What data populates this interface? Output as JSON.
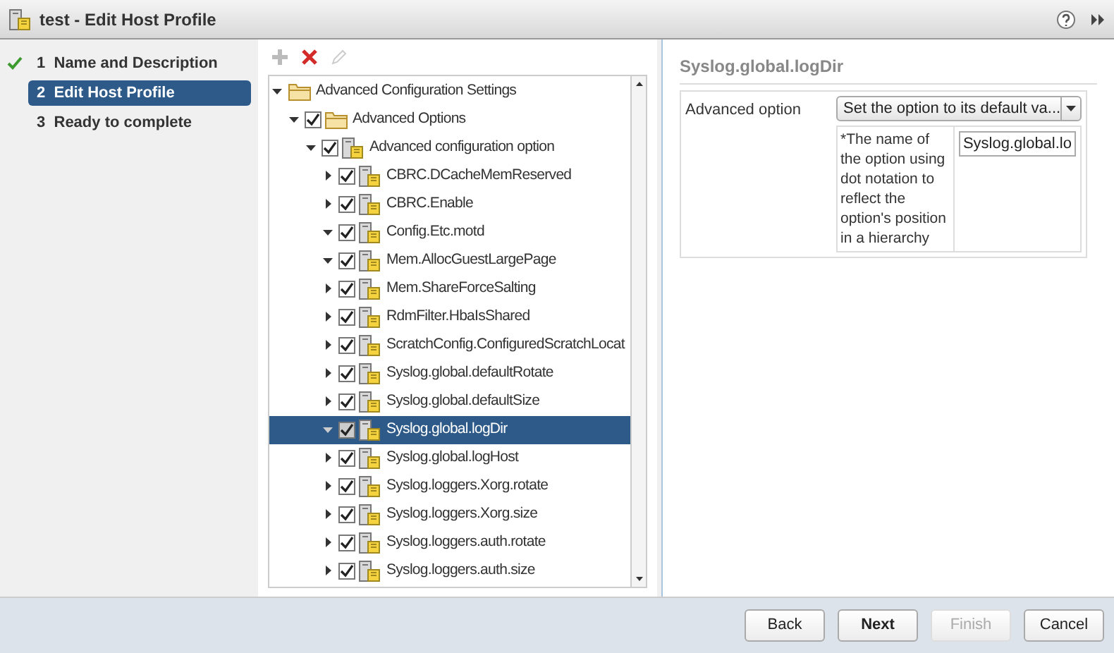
{
  "window": {
    "title": "test - Edit Host Profile"
  },
  "steps": [
    {
      "number": "1",
      "label": "Name and Description",
      "done": true,
      "selected": false
    },
    {
      "number": "2",
      "label": "Edit Host Profile",
      "done": false,
      "selected": true
    },
    {
      "number": "3",
      "label": "Ready to complete",
      "done": false,
      "selected": false
    }
  ],
  "tree": [
    {
      "label": "Advanced Configuration Settings",
      "kind": "folder",
      "expanded": true,
      "children": [
        {
          "label": "Advanced Options",
          "kind": "folder",
          "checked": true,
          "expanded": true,
          "children": [
            {
              "label": "Advanced configuration option",
              "kind": "profile",
              "checked": true,
              "expanded": true,
              "children": [
                {
                  "label": "CBRC.DCacheMemReserved",
                  "kind": "profile",
                  "checked": true,
                  "expanded": false,
                  "selected": false
                },
                {
                  "label": "CBRC.Enable",
                  "kind": "profile",
                  "checked": true,
                  "expanded": false,
                  "selected": false
                },
                {
                  "label": "Config.Etc.motd",
                  "kind": "profile",
                  "checked": true,
                  "expanded": true,
                  "selected": false
                },
                {
                  "label": "Mem.AllocGuestLargePage",
                  "kind": "profile",
                  "checked": true,
                  "expanded": true,
                  "selected": false
                },
                {
                  "label": "Mem.ShareForceSalting",
                  "kind": "profile",
                  "checked": true,
                  "expanded": false,
                  "selected": false
                },
                {
                  "label": "RdmFilter.HbaIsShared",
                  "kind": "profile",
                  "checked": true,
                  "expanded": false,
                  "selected": false
                },
                {
                  "label": "ScratchConfig.ConfiguredScratchLocat",
                  "kind": "profile",
                  "checked": true,
                  "expanded": false,
                  "selected": false
                },
                {
                  "label": "Syslog.global.defaultRotate",
                  "kind": "profile",
                  "checked": true,
                  "expanded": false,
                  "selected": false
                },
                {
                  "label": "Syslog.global.defaultSize",
                  "kind": "profile",
                  "checked": true,
                  "expanded": false,
                  "selected": false
                },
                {
                  "label": "Syslog.global.logDir",
                  "kind": "profile",
                  "checked": true,
                  "expanded": true,
                  "selected": true
                },
                {
                  "label": "Syslog.global.logHost",
                  "kind": "profile",
                  "checked": true,
                  "expanded": false,
                  "selected": false
                },
                {
                  "label": "Syslog.loggers.Xorg.rotate",
                  "kind": "profile",
                  "checked": true,
                  "expanded": false,
                  "selected": false
                },
                {
                  "label": "Syslog.loggers.Xorg.size",
                  "kind": "profile",
                  "checked": true,
                  "expanded": false,
                  "selected": false
                },
                {
                  "label": "Syslog.loggers.auth.rotate",
                  "kind": "profile",
                  "checked": true,
                  "expanded": false,
                  "selected": false
                },
                {
                  "label": "Syslog.loggers.auth.size",
                  "kind": "profile",
                  "checked": true,
                  "expanded": false,
                  "selected": false
                }
              ]
            }
          ]
        }
      ]
    }
  ],
  "detail": {
    "title": "Syslog.global.logDir",
    "option_label": "Advanced option",
    "dropdown": "Set the option to its default va...",
    "field_description": "*The name of the option using dot notation to reflect the option's position in a hierarchy",
    "field_value": "Syslog.global.lo"
  },
  "buttons": [
    {
      "label": "Back",
      "kind": "normal"
    },
    {
      "label": "Next",
      "kind": "primary"
    },
    {
      "label": "Finish",
      "kind": "disabled"
    },
    {
      "label": "Cancel",
      "kind": "normal"
    }
  ]
}
